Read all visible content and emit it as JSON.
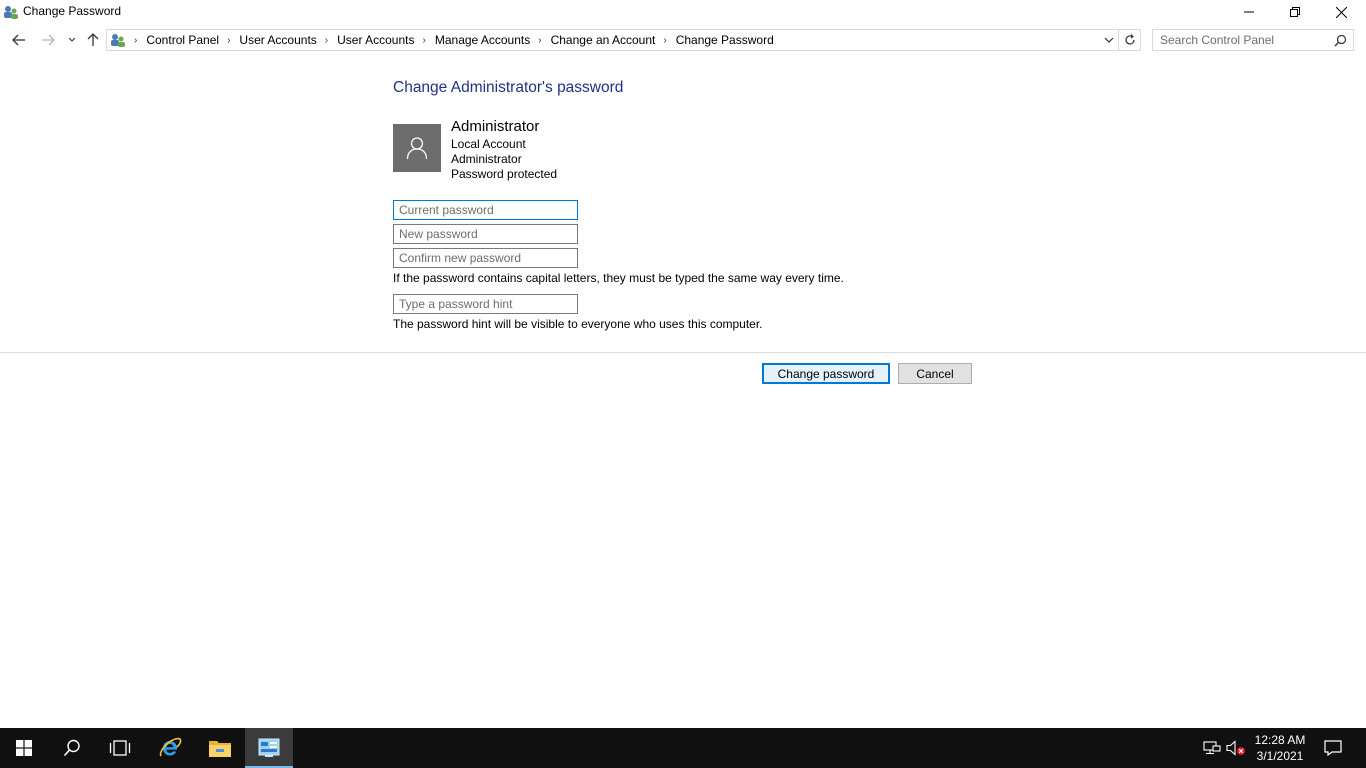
{
  "window": {
    "title": "Change Password",
    "icon": "control-panel-icon"
  },
  "navigation": {
    "breadcrumbs": [
      "Control Panel",
      "User Accounts",
      "User Accounts",
      "Manage Accounts",
      "Change an Account",
      "Change Password"
    ],
    "search_placeholder": "Search Control Panel"
  },
  "content": {
    "heading": "Change Administrator's password",
    "account": {
      "name": "Administrator",
      "type": "Local Account",
      "role": "Administrator",
      "status": "Password protected"
    },
    "fields": {
      "current_placeholder": "Current password",
      "new_placeholder": "New password",
      "confirm_placeholder": "Confirm new password",
      "hint_placeholder": "Type a password hint"
    },
    "caps_note": "If the password contains capital letters, they must be typed the same way every time.",
    "hint_note": "The password hint will be visible to everyone who uses this computer.",
    "buttons": {
      "change": "Change password",
      "cancel": "Cancel"
    }
  },
  "taskbar": {
    "clock_time": "12:28 AM",
    "clock_date": "3/1/2021"
  },
  "colors": {
    "heading": "#1e3287",
    "accent": "#0078d7",
    "taskbar": "#101010",
    "avatar": "#6d6d6d"
  }
}
